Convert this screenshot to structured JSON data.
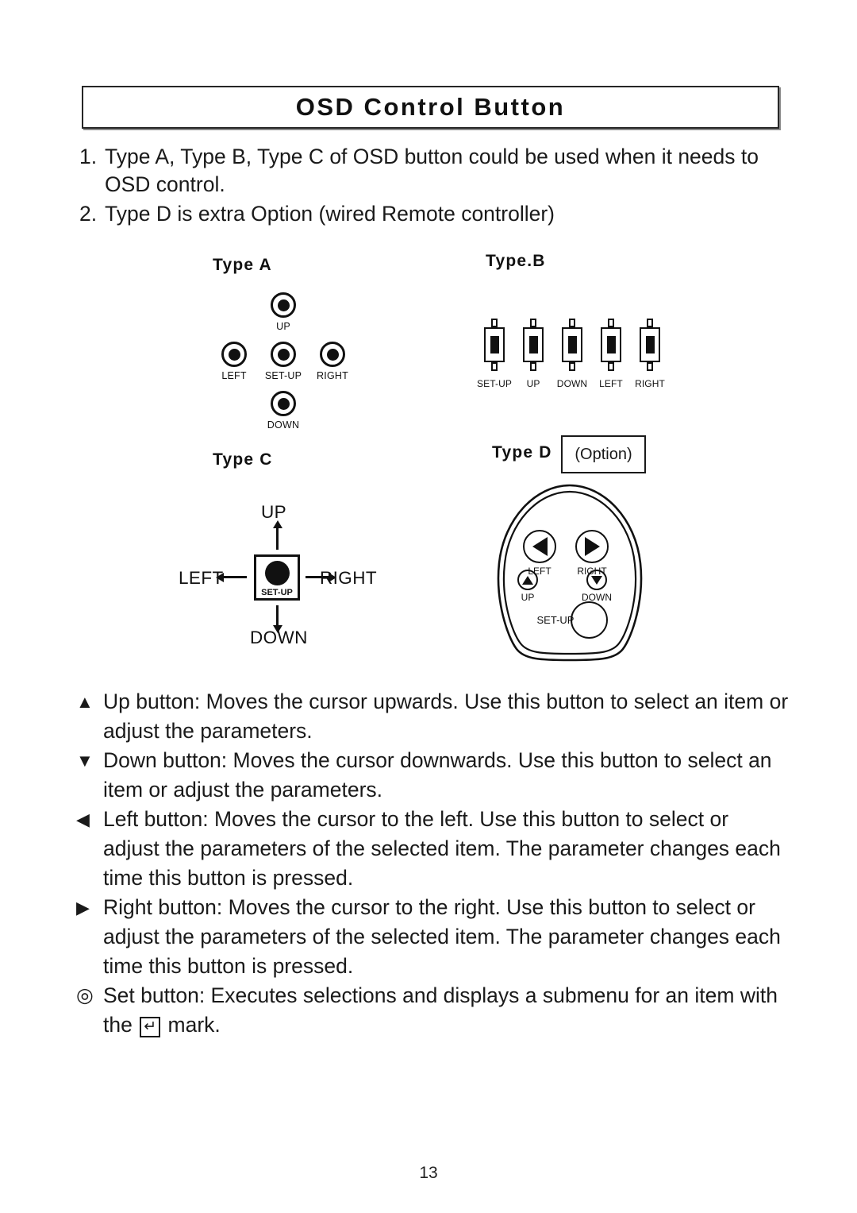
{
  "page": {
    "title": "OSD Control Button",
    "page_number": "13"
  },
  "intro": {
    "items": [
      {
        "num": "1.",
        "text": "Type A, Type B, Type C of OSD button could be used when it needs to OSD control."
      },
      {
        "num": "2.",
        "text": "Type D is extra Option (wired Remote controller)"
      }
    ]
  },
  "diagrams": {
    "type_a": {
      "label": "Type A",
      "buttons": [
        {
          "key": "up",
          "caption": "UP"
        },
        {
          "key": "left",
          "caption": "LEFT"
        },
        {
          "key": "setup",
          "caption": "SET-UP"
        },
        {
          "key": "right",
          "caption": "RIGHT"
        },
        {
          "key": "down",
          "caption": "DOWN"
        }
      ]
    },
    "type_b": {
      "label": "Type.B",
      "buttons": [
        {
          "key": "setup",
          "caption": "SET-UP"
        },
        {
          "key": "up",
          "caption": "UP"
        },
        {
          "key": "down",
          "caption": "DOWN"
        },
        {
          "key": "left",
          "caption": "LEFT"
        },
        {
          "key": "right",
          "caption": "RIGHT"
        }
      ]
    },
    "type_c": {
      "label": "Type C",
      "center_caption": "SET-UP",
      "directions": {
        "up": "UP",
        "down": "DOWN",
        "left": "LEFT",
        "right": "RIGHT"
      }
    },
    "type_d": {
      "label": "Type D",
      "option_badge": "(Option)",
      "buttons": [
        {
          "key": "left",
          "caption": "LEFT"
        },
        {
          "key": "right",
          "caption": "RIGHT"
        },
        {
          "key": "up",
          "caption": "UP"
        },
        {
          "key": "down",
          "caption": "DOWN"
        },
        {
          "key": "setup",
          "caption": "SET-UP"
        }
      ]
    }
  },
  "bullets": [
    {
      "mark": "▲",
      "text": "Up button: Moves the cursor upwards. Use this button to select an item or adjust the parameters."
    },
    {
      "mark": "▼",
      "text": "Down button: Moves the cursor downwards. Use this button to select an item or adjust the parameters."
    },
    {
      "mark": "◀",
      "text": "Left button: Moves the cursor to the left. Use this button to select or adjust the parameters of the selected item. The parameter changes each time this button is pressed."
    },
    {
      "mark": "▶",
      "text": "Right button: Moves the cursor to the right. Use this button to select or adjust the parameters of the selected item. The parameter changes each time this button is pressed."
    },
    {
      "mark": "◎",
      "text_before": "Set button: Executes selections and displays a submenu for an item with the",
      "enter_glyph": "↵",
      "text_after": "mark."
    }
  ],
  "colors": {
    "ink": "#1a1a1a",
    "line": "#111111",
    "paper": "#ffffff"
  }
}
